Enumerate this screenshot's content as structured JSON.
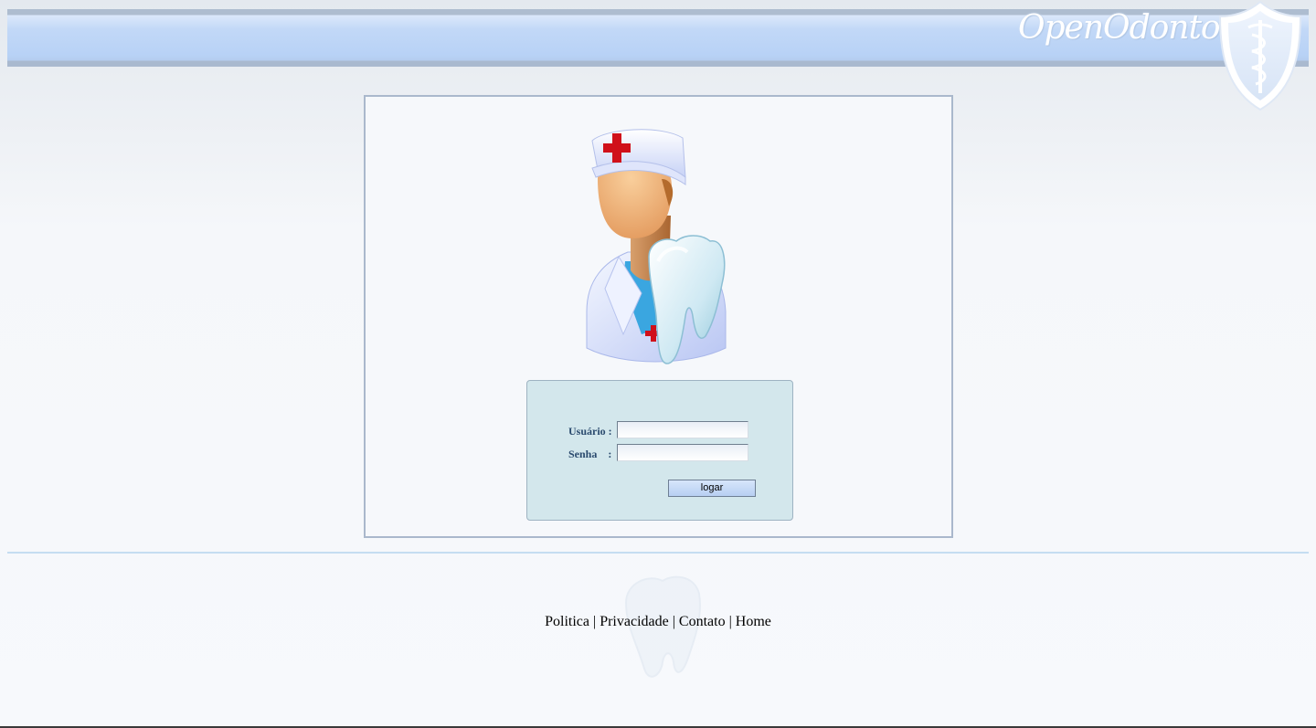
{
  "header": {
    "logo_text": "OpenOdonto",
    "colors": {
      "band": "#b8d2f6",
      "border": "#aebdd0"
    }
  },
  "login": {
    "user_label": "Usuário :",
    "password_label": "Senha    :",
    "user_value": "",
    "password_value": "",
    "submit_label": "logar"
  },
  "footer": {
    "links": [
      "Politica",
      "Privacidade",
      "Contato",
      "Home"
    ],
    "separator": "|"
  },
  "icons": [
    "dentist-avatar-icon",
    "tooth-icon",
    "shield-caduceus-icon",
    "tooth-watermark-icon"
  ]
}
